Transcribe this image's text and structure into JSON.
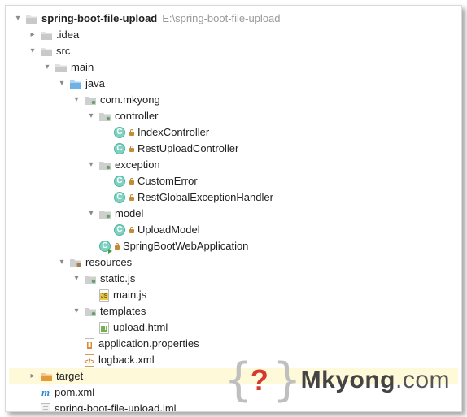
{
  "root": {
    "name": "spring-boot-file-upload",
    "path": "E:\\spring-boot-file-upload"
  },
  "rows": [
    {
      "indent": 0,
      "arrow": "down",
      "icon": "folder",
      "label": "spring-boot-file-upload",
      "bold": true,
      "path": "E:\\spring-boot-file-upload"
    },
    {
      "indent": 1,
      "arrow": "right",
      "icon": "folder",
      "label": ".idea"
    },
    {
      "indent": 1,
      "arrow": "down",
      "icon": "folder",
      "label": "src"
    },
    {
      "indent": 2,
      "arrow": "down",
      "icon": "folder",
      "label": "main"
    },
    {
      "indent": 3,
      "arrow": "down",
      "icon": "folder-blue",
      "label": "java"
    },
    {
      "indent": 4,
      "arrow": "down",
      "icon": "folder-pkg",
      "label": "com.mkyong"
    },
    {
      "indent": 5,
      "arrow": "down",
      "icon": "folder-pkg",
      "label": "controller"
    },
    {
      "indent": 6,
      "arrow": "",
      "icon": "class",
      "label": "IndexController",
      "lock": true
    },
    {
      "indent": 6,
      "arrow": "",
      "icon": "class",
      "label": "RestUploadController",
      "lock": true
    },
    {
      "indent": 5,
      "arrow": "down",
      "icon": "folder-pkg",
      "label": "exception"
    },
    {
      "indent": 6,
      "arrow": "",
      "icon": "class",
      "label": "CustomError",
      "lock": true
    },
    {
      "indent": 6,
      "arrow": "",
      "icon": "class",
      "label": "RestGlobalExceptionHandler",
      "lock": true
    },
    {
      "indent": 5,
      "arrow": "down",
      "icon": "folder-pkg",
      "label": "model"
    },
    {
      "indent": 6,
      "arrow": "",
      "icon": "class",
      "label": "UploadModel",
      "lock": true
    },
    {
      "indent": 5,
      "arrow": "",
      "icon": "class-run",
      "label": "SpringBootWebApplication",
      "lock": true
    },
    {
      "indent": 3,
      "arrow": "down",
      "icon": "folder-res",
      "label": "resources"
    },
    {
      "indent": 4,
      "arrow": "down",
      "icon": "folder-pkg",
      "label": "static.js"
    },
    {
      "indent": 5,
      "arrow": "",
      "icon": "js",
      "label": "main.js"
    },
    {
      "indent": 4,
      "arrow": "down",
      "icon": "folder-pkg",
      "label": "templates"
    },
    {
      "indent": 5,
      "arrow": "",
      "icon": "html",
      "label": "upload.html"
    },
    {
      "indent": 4,
      "arrow": "",
      "icon": "props",
      "label": "application.properties"
    },
    {
      "indent": 4,
      "arrow": "",
      "icon": "xml",
      "label": "logback.xml"
    },
    {
      "indent": 1,
      "arrow": "right",
      "icon": "folder-orange",
      "label": "target",
      "selected": true
    },
    {
      "indent": 1,
      "arrow": "",
      "icon": "maven",
      "label": "pom.xml"
    },
    {
      "indent": 1,
      "arrow": "",
      "icon": "iml",
      "label": "spring-boot-file-upload.iml"
    }
  ],
  "watermark": {
    "brand": "Mkyong",
    "suffix": ".com"
  }
}
